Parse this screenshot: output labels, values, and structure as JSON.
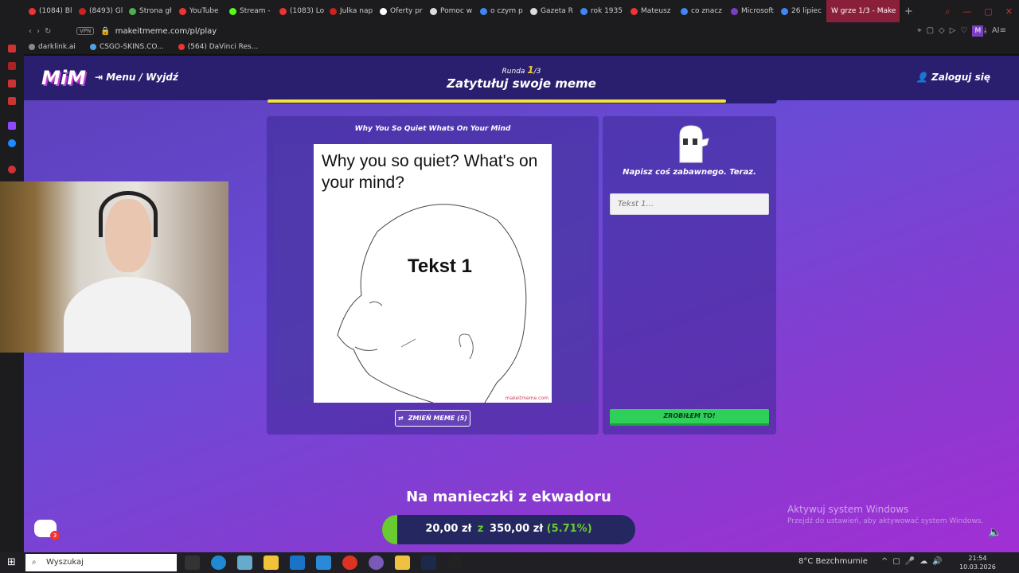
{
  "browser": {
    "tabs": [
      {
        "label": "(1084) Bl",
        "color": "#e33"
      },
      {
        "label": "(8493) Gl",
        "color": "#c22"
      },
      {
        "label": "Strona gł",
        "color": "#4caf50"
      },
      {
        "label": "YouTube",
        "color": "#e33"
      },
      {
        "label": "Stream -",
        "color": "#53fc18"
      },
      {
        "label": "(1083) Lo",
        "color": "#e33"
      },
      {
        "label": "Julka nap",
        "color": "#c22"
      },
      {
        "label": "Oferty pr",
        "color": "#fff"
      },
      {
        "label": "Pomoc w",
        "color": "#ddd"
      },
      {
        "label": "o czym p",
        "color": "#4285f4"
      },
      {
        "label": "Gazeta R",
        "color": "#ddd"
      },
      {
        "label": "rok 1935",
        "color": "#4285f4"
      },
      {
        "label": "Mateusz",
        "color": "#e33"
      },
      {
        "label": "co znacz",
        "color": "#4285f4"
      },
      {
        "label": "Microsoft",
        "color": "#7b3fc4"
      },
      {
        "label": "26 lipiec",
        "color": "#4285f4"
      }
    ],
    "active_tab": "W grze 1/3 - Make",
    "url": "makeitmeme.com/pl/play",
    "vpn_label": "VPN",
    "ai_label": "AI",
    "profile_initial": "M",
    "bookmarks": [
      {
        "label": "darklink.ai",
        "color": "#888"
      },
      {
        "label": "CSGO-SKINS.CO...",
        "color": "#4fa3e0"
      },
      {
        "label": "(564) DaVinci Res...",
        "color": "#e33"
      }
    ]
  },
  "game": {
    "logo": "MiM",
    "menu_label": "Menu / Wyjdź",
    "round_prefix": "Runda",
    "round_current": "1",
    "round_total": "/3",
    "title": "Zatytułuj swoje meme",
    "login_label": "Zaloguj się",
    "timer_progress": 0.9,
    "meme_template_title": "Why You So Quiet Whats On Your Mind",
    "meme_caption": "Why you so quiet? What's on your mind?",
    "meme_text_slot": "Tekst 1",
    "meme_watermark": "makeitmeme.com",
    "swap_button": "ZMIEŃ MEME (5)",
    "prompt": "Napisz coś zabawnego. Teraz.",
    "input_placeholder": "Tekst 1...",
    "submit_button": "ZROBIŁEM TO!"
  },
  "fundraiser": {
    "title": "Na manieczki z ekwadoru",
    "current": "20,00 zł",
    "separator": "z",
    "goal": "350,00 zł",
    "percent": "(5.71%)",
    "progress": 0.0571
  },
  "windows_watermark": {
    "line1": "Aktywuj system Windows",
    "line2": "Przejdź do ustawień, aby aktywować system Windows."
  },
  "chat_badge": "3",
  "taskbar": {
    "search_placeholder": "Wyszukaj",
    "weather": "8°C  Bezchmurnie",
    "time": "21:54",
    "date": "10.03.2026"
  }
}
